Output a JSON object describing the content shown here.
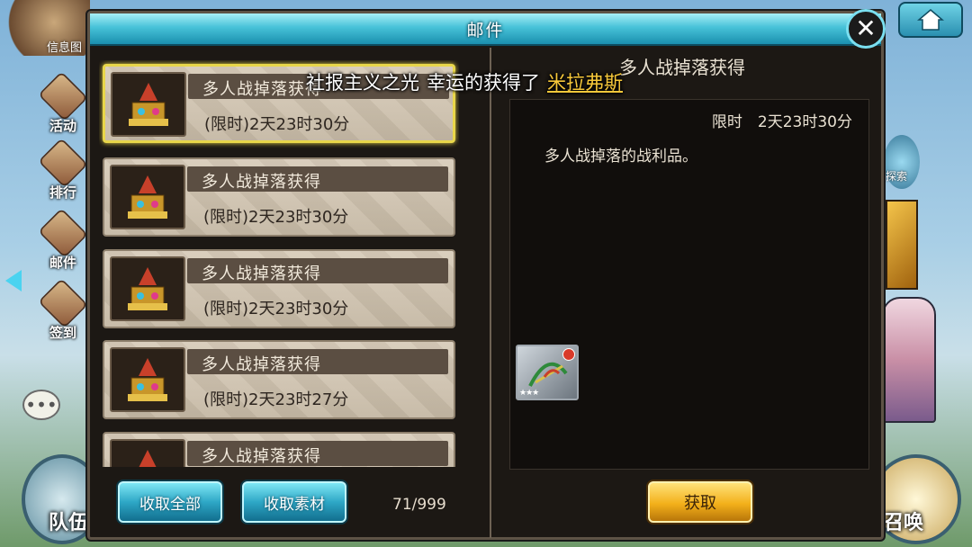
{
  "hud": {
    "info_label": "信息图",
    "side_buttons": [
      "活动",
      "排行",
      "邮件",
      "签到"
    ],
    "bottom_left": "队伍",
    "bottom_right": "召唤",
    "right_top_label": "探索"
  },
  "dialog": {
    "title": "邮件",
    "close_label": "✕"
  },
  "broadcast": {
    "prefix": "社报主义之光",
    "middle": "幸运的获得了",
    "item": "米拉弗斯"
  },
  "mail_list": {
    "items": [
      {
        "title": "多人战掉落获得",
        "expire": "(限时)2天23时30分",
        "selected": true
      },
      {
        "title": "多人战掉落获得",
        "expire": "(限时)2天23时30分",
        "selected": false
      },
      {
        "title": "多人战掉落获得",
        "expire": "(限时)2天23时30分",
        "selected": false
      },
      {
        "title": "多人战掉落获得",
        "expire": "(限时)2天23时27分",
        "selected": false
      },
      {
        "title": "多人战掉落获得",
        "expire": "",
        "selected": false
      }
    ],
    "claim_all_label": "收取全部",
    "claim_materials_label": "收取素材",
    "count": "71/999"
  },
  "detail": {
    "title": "多人战掉落获得",
    "expire": "限时　2天23时30分",
    "description": "多人战掉落的战利品。",
    "reward_stars": "★★★",
    "claim_label": "获取"
  },
  "colors": {
    "header_teal": "#47c2d8",
    "highlight_gold": "#f7c83a",
    "selected_border": "#e8d64a"
  }
}
